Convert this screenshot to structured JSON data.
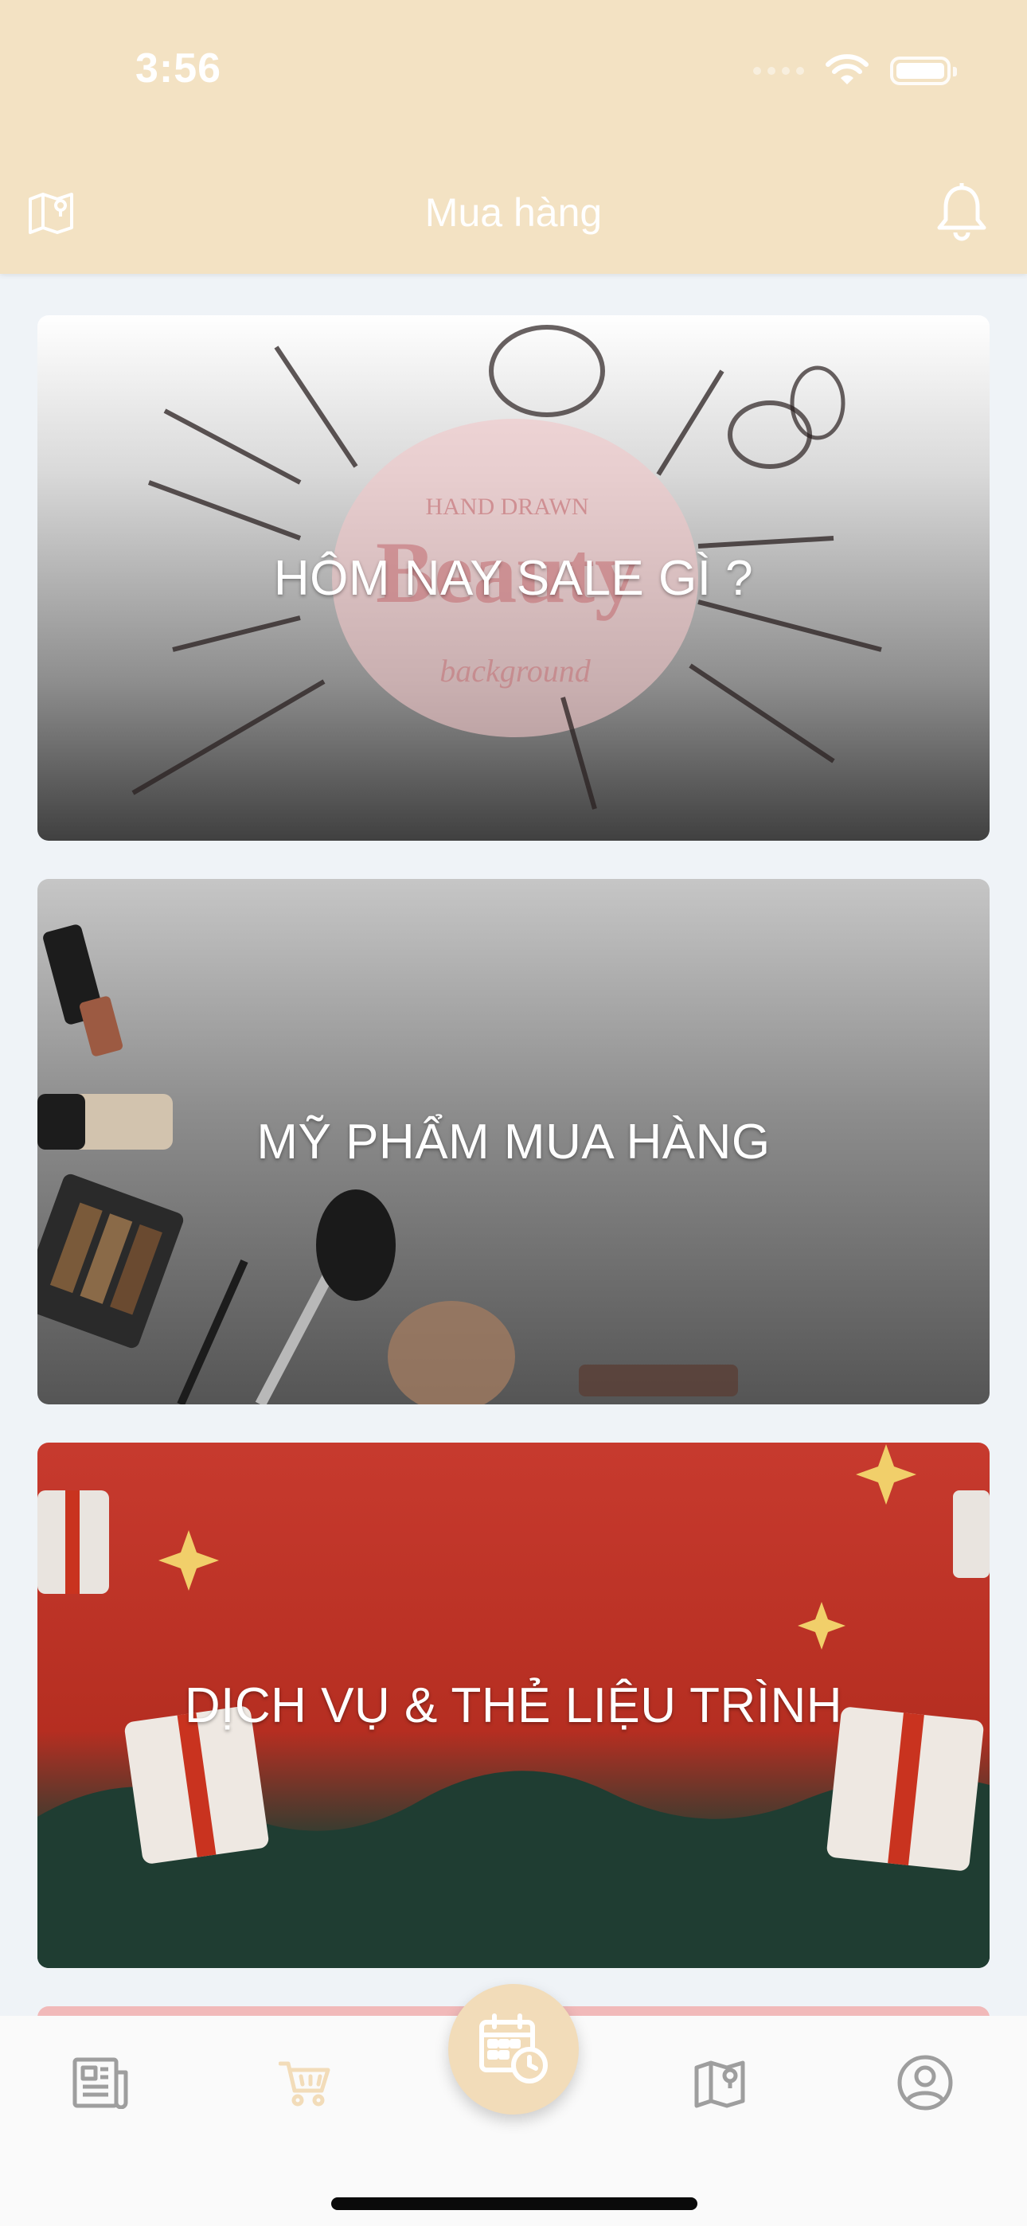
{
  "status_bar": {
    "time": "3:56"
  },
  "nav": {
    "title": "Mua hàng",
    "left_icon": "map-icon",
    "right_icon": "bell-icon"
  },
  "cards": [
    {
      "label": "HÔM NAY SALE GÌ ?",
      "image": "makeup-sketch-banner",
      "logo_lines": [
        "HAND DRAWN",
        "Beauty",
        "background"
      ]
    },
    {
      "label": "MỸ PHẨM MUA HÀNG",
      "image": "cosmetics-photo-banner"
    },
    {
      "label": "DỊCH VỤ & THẺ LIỆU TRÌNH",
      "image": "gift-boxes-banner"
    }
  ],
  "tabbar": {
    "items": [
      {
        "name": "news",
        "icon": "newspaper-icon",
        "active": false
      },
      {
        "name": "cart",
        "icon": "cart-icon",
        "active": true
      },
      {
        "name": "booking",
        "icon": "calendar-clock-icon",
        "active": false
      },
      {
        "name": "map",
        "icon": "map-icon",
        "active": false
      },
      {
        "name": "profile",
        "icon": "user-circle-icon",
        "active": false
      }
    ]
  },
  "colors": {
    "header": "#f3e2c3",
    "accent": "#f2dcb9",
    "background": "#eff3f7",
    "inactive_icon": "#9e9e9e"
  }
}
